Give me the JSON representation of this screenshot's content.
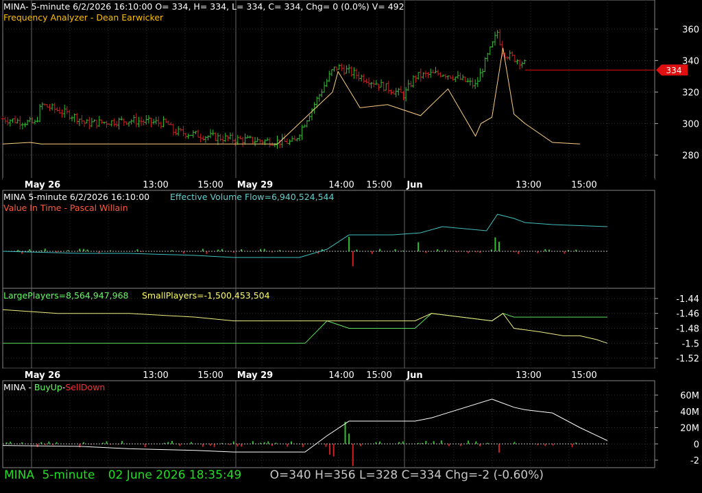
{
  "panel1": {
    "title": "MINA- 5-minute 6/2/2026 16:10:00 O= 334, H= 334, L= 334, C= 334, Chg= 0 (0.0%) V= 492",
    "indicator": "Frequency Analyzer - Dean Earwicker",
    "last_price_badge": "334"
  },
  "panel2": {
    "title": "MINA 5-minute  6/2/2026 16:10:00",
    "evf_label": "Effective Volume Flow=6,940,524,544",
    "indicator": "Value In Time - Pascal Willain"
  },
  "panel3": {
    "large_label": "LargePlayers=8,564,947,968",
    "small_label": "SmallPlayers=-1,500,453,504"
  },
  "panel4": {
    "symbol": "MINA",
    "sep1": " - ",
    "buy_label": "BuyUp",
    "sep2": "-",
    "sell_label": "SellDown"
  },
  "status": {
    "symbol": "MINA",
    "interval": "5-minute",
    "datetime": "02 June 2026 18:35:49",
    "ohlc": "O=340  H=356  L=328  C=334  Chg=-2 (-0.60%)"
  },
  "colors": {
    "up": "#30c030",
    "down": "#d02020",
    "freq": "#ffd080",
    "evf": "#40c0c0",
    "large": "#60e060",
    "small": "#f0f080",
    "badge": "#e01010"
  },
  "chart_data": [
    {
      "type": "line",
      "title": "MINA- 5-minute 6/2/2026 16:10:00 O= 334, H= 334, L= 334, C= 334, Chg= 0 (0.0%) V= 492",
      "x_ticks": [
        "May 26",
        "13:00",
        "15:00",
        "May 29",
        "14:00",
        "15:00",
        "Jun",
        "13:00",
        "15:00"
      ],
      "y_ticks": [
        280,
        300,
        320,
        340,
        360
      ],
      "ylim": [
        268,
        368
      ],
      "last_price": 334,
      "series": [
        {
          "name": "Price",
          "style": "ohlc",
          "x": [
            0,
            12,
            14,
            24,
            28,
            30,
            46,
            60,
            62,
            74,
            84,
            106,
            120,
            122,
            146,
            150,
            160,
            164,
            172,
            180,
            182,
            190
          ],
          "y": [
            303,
            300,
            312,
            306,
            303,
            300,
            302,
            300,
            295,
            292,
            290,
            288,
            334,
            336,
            318,
            330,
            332,
            330,
            324,
            358,
            345,
            338
          ]
        },
        {
          "name": "Frequency Analyzer",
          "style": "line",
          "x": [
            0,
            10,
            14,
            22,
            28,
            44,
            58,
            74,
            84,
            100,
            120,
            122,
            130,
            140,
            152,
            162,
            172,
            174,
            178,
            182,
            186,
            190,
            200,
            210
          ],
          "y": [
            287,
            288,
            287,
            287,
            287,
            287,
            287,
            287,
            287,
            287,
            320,
            333,
            310,
            312,
            305,
            322,
            292,
            300,
            304,
            348,
            306,
            300,
            288,
            287
          ]
        }
      ]
    },
    {
      "type": "bar",
      "title": "MINA 5-minute  6/2/2026 16:10:00",
      "series": [
        {
          "name": "Effective Volume Flow",
          "style": "line",
          "x": [
            0,
            28,
            46,
            70,
            84,
            96,
            108,
            118,
            126,
            142,
            152,
            160,
            176,
            180,
            186,
            190,
            200,
            220
          ],
          "y": [
            0,
            -1,
            -1,
            -2,
            -3,
            -3,
            -3,
            1,
            8,
            8,
            9,
            12,
            10,
            18,
            16,
            14,
            13,
            12
          ]
        }
      ]
    },
    {
      "type": "line",
      "y_ticks": [
        -1.44,
        -1.46,
        -1.48,
        -1.5,
        -1.52
      ],
      "ylim": [
        -1.53,
        -1.43
      ],
      "series": [
        {
          "name": "LargePlayers",
          "x": [
            0,
            20,
            46,
            70,
            84,
            96,
            110,
            118,
            126,
            150,
            156,
            178,
            182,
            186,
            190,
            200,
            220
          ],
          "y": [
            -1.5,
            -1.5,
            -1.5,
            -1.5,
            -1.5,
            -1.5,
            -1.5,
            -1.47,
            -1.48,
            -1.48,
            -1.46,
            -1.47,
            -1.46,
            -1.465,
            -1.465,
            -1.465,
            -1.465
          ]
        },
        {
          "name": "SmallPlayers",
          "x": [
            0,
            20,
            46,
            70,
            84,
            96,
            110,
            118,
            126,
            150,
            156,
            178,
            182,
            186,
            196,
            204,
            210,
            216,
            220
          ],
          "y": [
            -1.455,
            -1.46,
            -1.46,
            -1.465,
            -1.47,
            -1.47,
            -1.47,
            -1.47,
            -1.47,
            -1.47,
            -1.46,
            -1.47,
            -1.46,
            -1.48,
            -1.485,
            -1.49,
            -1.49,
            -1.495,
            -1.5
          ]
        }
      ]
    },
    {
      "type": "bar",
      "y_ticks": [
        "60M",
        "40M",
        "20M",
        "0",
        "-2"
      ],
      "ylim": [
        -25,
        70
      ],
      "series": [
        {
          "name": "BuyUp-SellDown",
          "style": "line",
          "x": [
            0,
            28,
            46,
            70,
            84,
            96,
            110,
            118,
            126,
            150,
            156,
            178,
            182,
            186,
            190,
            200,
            210,
            220
          ],
          "y": [
            -2,
            -3,
            -6,
            -8,
            -10,
            -10,
            -10,
            10,
            28,
            28,
            32,
            55,
            50,
            45,
            42,
            38,
            20,
            4
          ]
        }
      ]
    }
  ]
}
